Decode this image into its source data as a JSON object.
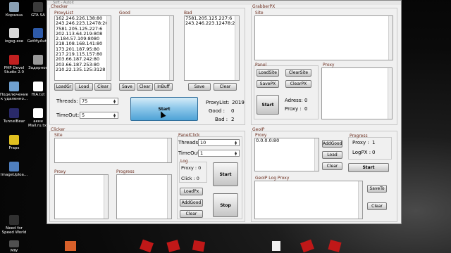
{
  "window": {
    "title": "Soft - Autoit"
  },
  "desktop_icons": [
    {
      "label": "Корзина"
    },
    {
      "label": "GTA SA"
    },
    {
      "label": "iogsg.exe"
    },
    {
      "label": "GetMyAuth"
    },
    {
      "label": "PHP Devel Studio 2.0"
    },
    {
      "label": "Задорнов"
    },
    {
      "label": "Подключение к удаленно..."
    },
    {
      "label": "HIA.txt"
    },
    {
      "label": "TunnelBear"
    },
    {
      "label": "акки Mail.ru.txt"
    },
    {
      "label": "Fraps"
    },
    {
      "label": "ImageUploa..."
    },
    {
      "label": "Need for Speed World"
    },
    {
      "label": "MW"
    }
  ],
  "checker": {
    "label": "Checker",
    "proxylist_label": "ProxyList",
    "proxylist": [
      "162.246.226.138:80",
      "243.246.223.12478:268",
      "7581.205.125.227:6",
      "202.113.64.219:808",
      "2.184.57.109:8080",
      "218.108.168.141:80",
      "173.201.187.95:80",
      "217.219.115.157:80",
      "203.66.187.242:80",
      "203.66.187.253:80",
      "210.22.135.125:3128"
    ],
    "good_label": "Good",
    "bad_label": "Bad",
    "bad_list": [
      "7581.205.125.227:6",
      "243.246.223.12478:268"
    ],
    "buttons_proxy": [
      "LoadGr",
      "Load",
      "Clear"
    ],
    "buttons_good": [
      "Save",
      "Clear",
      "InBuff"
    ],
    "buttons_bad": [
      "Save",
      "Clear"
    ],
    "threads_label": "Threads:",
    "threads_value": "75",
    "timeout_label": "TimeOut:",
    "timeout_value": "5",
    "start_label": "Start",
    "stats": [
      {
        "label": "ProxyList:",
        "value": "2019"
      },
      {
        "label": "Good :",
        "value": "0"
      },
      {
        "label": "Bad :",
        "value": "2"
      }
    ]
  },
  "grabber": {
    "label": "GrabberPX",
    "site_label": "Site",
    "panel_label": "Panel",
    "proxy_label": "Proxy",
    "buttons": [
      "LoadSite",
      "ClearSite",
      "SavePX",
      "ClearPX"
    ],
    "start_label": "Start",
    "stats": [
      {
        "label": "Adress:",
        "value": "0"
      },
      {
        "label": "Proxy :",
        "value": "0"
      }
    ]
  },
  "clicker": {
    "label": "Clicker",
    "site_label": "Site",
    "proxy_label": "Proxy",
    "progress_label": "Progress",
    "panel_label": "PanelClick",
    "threads_label": "Threads:",
    "threads_value": "10",
    "timeout_label": "TimeOut:",
    "timeout_value": "1",
    "log_label": "Log",
    "log_proxy": "Proxy : 0",
    "log_click": "Click : 0",
    "buttons": [
      "LoadPx",
      "AddGood",
      "Clear"
    ],
    "start_label": "Start",
    "stop_label": "Stop"
  },
  "geoip": {
    "label": "GeoIP",
    "proxy_label": "Proxy",
    "proxy_value": "0.0.0.0:80",
    "buttons": [
      "AddGood",
      "Load",
      "Clear"
    ],
    "progress_label": "Progress",
    "progress_proxy": "Proxy :",
    "progress_proxy_value": "1",
    "progress_logpx": "LogPX :",
    "progress_logpx_value": "0",
    "start_label": "Start",
    "log_label": "GeoIP Log Proxy",
    "log_buttons": [
      "SaveTo",
      "Clear"
    ]
  }
}
